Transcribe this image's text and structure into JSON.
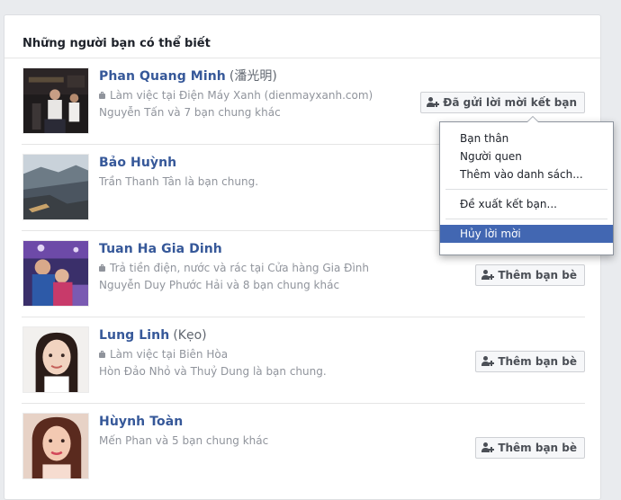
{
  "card": {
    "title": "Những người bạn có thể biết"
  },
  "people": [
    {
      "name": "Phan Quang Minh",
      "alias": "(潘光明)",
      "work": "Làm việc tại Điện Máy Xanh (dienmayxanh.com)",
      "mutual": "Nguyễn Tấn và 7 bạn chung khác",
      "button": "Đã gửi lời mời kết bạn"
    },
    {
      "name": "Bảo Huỳnh",
      "mutual": "Trần Thanh Tân là bạn chung."
    },
    {
      "name": "Tuan Ha Gia Dinh",
      "work": "Trả tiền điện, nước và rác tại Cửa hàng Gia Đình",
      "mutual": "Nguyễn Duy Phước Hải và 8 bạn chung khác",
      "button": "Thêm bạn bè"
    },
    {
      "name": "Lung Linh",
      "alias": "(Kẹo)",
      "work": "Làm việc tại Biên Hòa",
      "mutual": "Hòn Đảo Nhỏ và Thuỷ Dung là bạn chung.",
      "button": "Thêm bạn bè"
    },
    {
      "name": "Hùynh Toàn",
      "mutual": "Mến Phan và 5 bạn chung khác",
      "button": "Thêm bạn bè"
    }
  ],
  "menu": {
    "items": [
      "Bạn thân",
      "Người quen",
      "Thêm vào danh sách...",
      "Đề xuất kết bạn...",
      "Hủy lời mời"
    ],
    "active_index": 4
  },
  "colors": {
    "link": "#365899",
    "menu_highlight": "#4267b2",
    "background": "#e9ebee"
  }
}
